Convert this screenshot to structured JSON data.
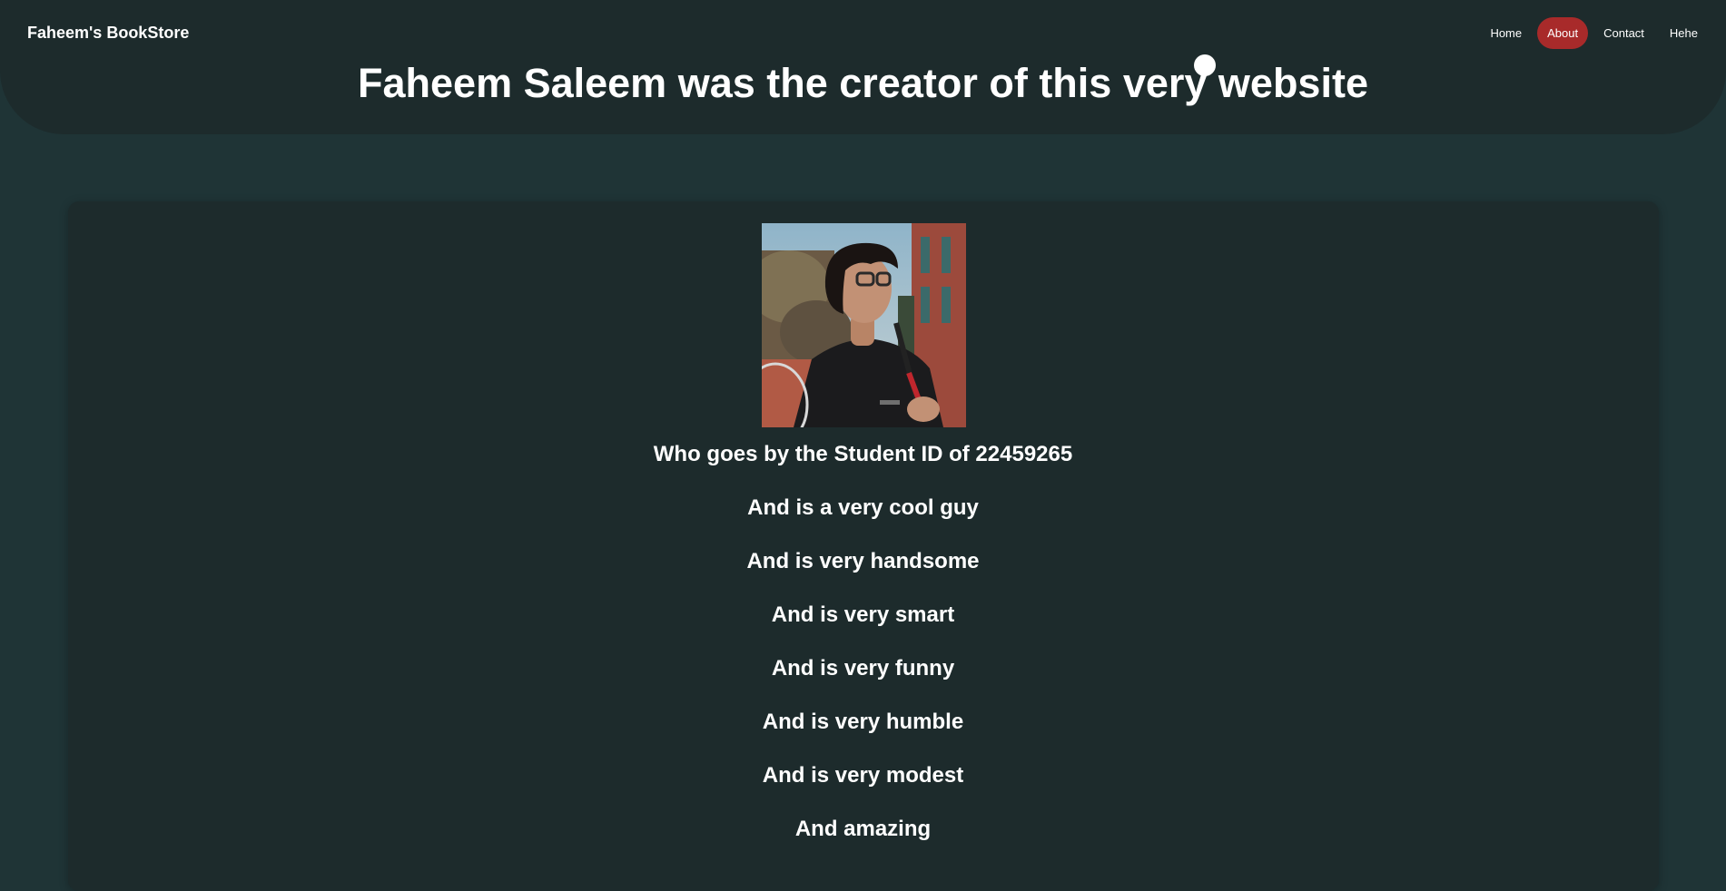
{
  "header": {
    "brand": "Faheem's BookStore",
    "nav": [
      {
        "label": "Home",
        "active": false
      },
      {
        "label": "About",
        "active": true
      },
      {
        "label": "Contact",
        "active": false
      },
      {
        "label": "Hehe",
        "active": false
      }
    ],
    "headline": "Faheem Saleem was the creator of this very website"
  },
  "main": {
    "lines": [
      "Who goes by the Student ID of 22459265",
      "And is a very cool guy",
      "And is very handsome",
      "And is very smart",
      "And is very funny",
      "And is very humble",
      "And is very modest",
      "And amazing"
    ]
  },
  "colors": {
    "page_background": "#1f3436",
    "panel_background": "#1d2b2c",
    "active_nav": "#a82a2a",
    "text": "#ffffff"
  }
}
